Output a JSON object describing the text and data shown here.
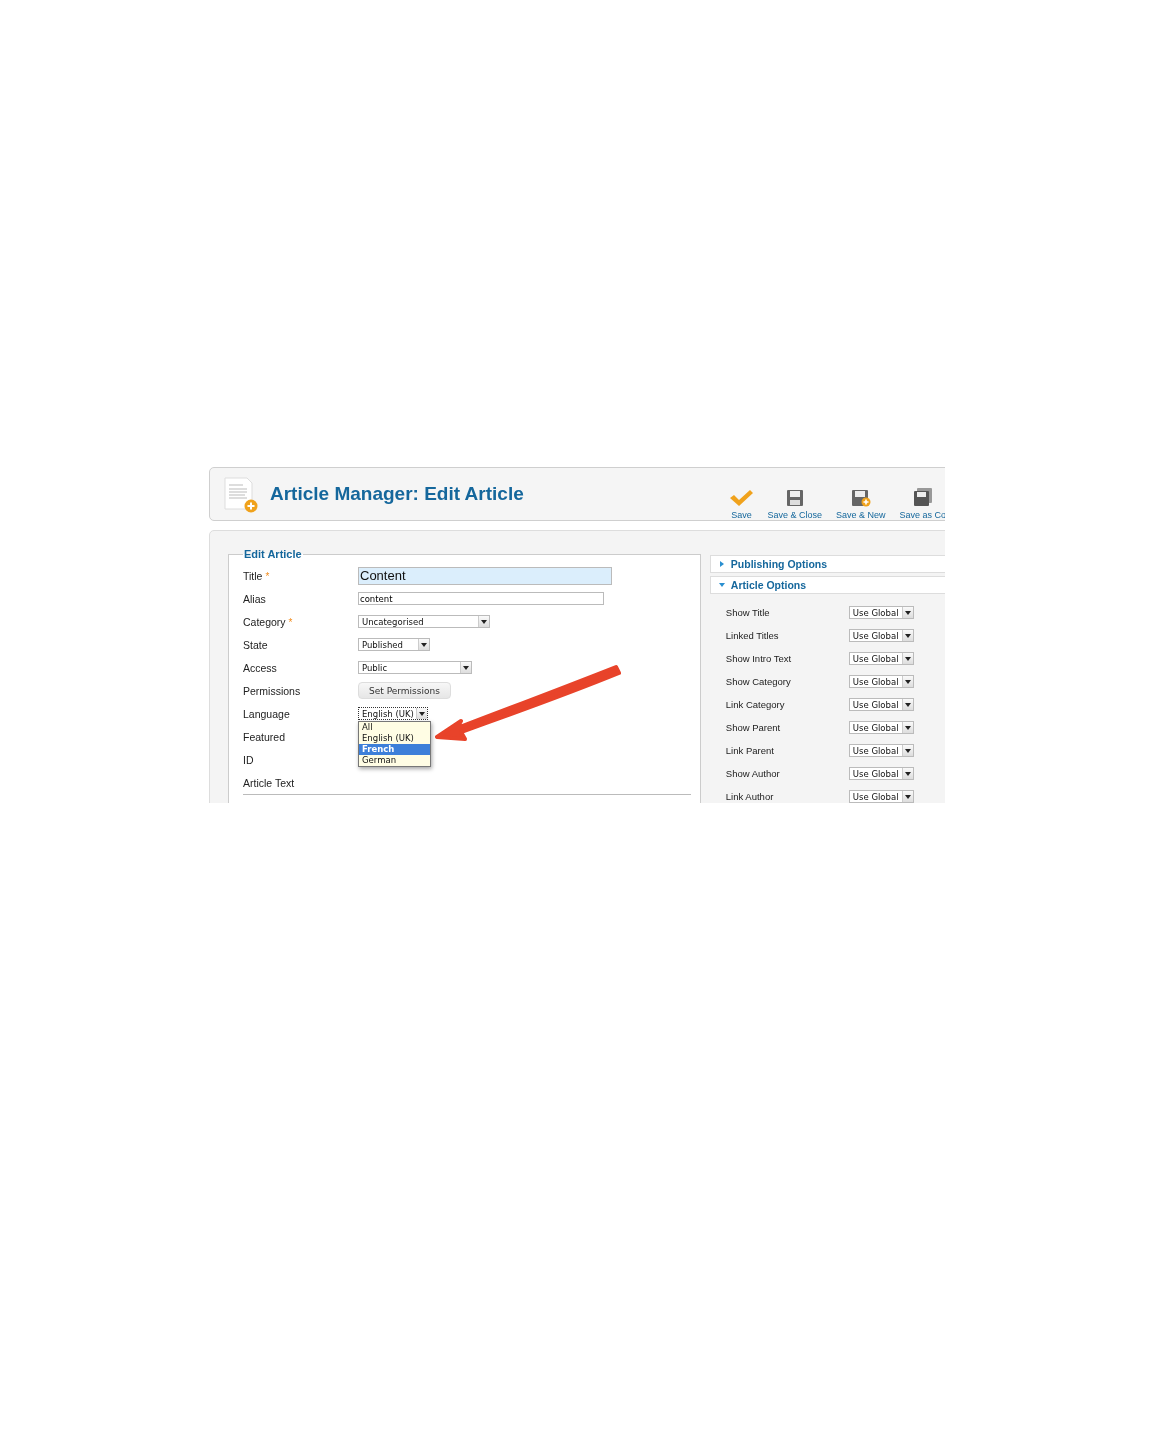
{
  "header": {
    "title": "Article Manager: Edit Article"
  },
  "toolbar": [
    {
      "label": "Save",
      "kind": "check"
    },
    {
      "label": "Save & Close",
      "kind": "disk"
    },
    {
      "label": "Save & New",
      "kind": "disk-plus"
    },
    {
      "label": "Save as Co",
      "kind": "disk-copy"
    }
  ],
  "edit_article": {
    "legend": "Edit Article",
    "fields": [
      {
        "label": "Title",
        "marker": "*",
        "kind": "title-input",
        "value": "Content"
      },
      {
        "label": "Alias",
        "kind": "input",
        "value": "content"
      },
      {
        "label": "Category",
        "marker": "*",
        "kind": "select",
        "value": "Uncategorised",
        "focused": false
      },
      {
        "label": "State",
        "kind": "select",
        "value": "Published",
        "focused": false
      },
      {
        "label": "Access",
        "kind": "select",
        "value": "Public",
        "focused": false
      },
      {
        "label": "Permissions",
        "kind": "button",
        "value": "Set Permissions"
      },
      {
        "label": "Language",
        "kind": "select",
        "value": "English (UK)",
        "focused": true,
        "options": [
          {
            "label": "All",
            "highlighted": false
          },
          {
            "label": "English (UK)",
            "highlighted": false
          },
          {
            "label": "French",
            "highlighted": true
          },
          {
            "label": "German",
            "highlighted": false
          }
        ]
      },
      {
        "label": "Featured",
        "kind": "none"
      },
      {
        "label": "ID",
        "kind": "none"
      },
      {
        "label": "Article Text",
        "kind": "none"
      }
    ]
  },
  "panels": [
    {
      "title": "Publishing Options",
      "expanded": false
    },
    {
      "title": "Article Options",
      "expanded": true,
      "options": [
        {
          "label": "Show Title",
          "value": "Use Global"
        },
        {
          "label": "Linked Titles",
          "value": "Use Global"
        },
        {
          "label": "Show Intro Text",
          "value": "Use Global"
        },
        {
          "label": "Show Category",
          "value": "Use Global"
        },
        {
          "label": "Link Category",
          "value": "Use Global"
        },
        {
          "label": "Show Parent",
          "value": "Use Global"
        },
        {
          "label": "Link Parent",
          "value": "Use Global"
        },
        {
          "label": "Show Author",
          "value": "Use Global"
        },
        {
          "label": "Link Author",
          "value": "Use Global"
        }
      ]
    }
  ]
}
